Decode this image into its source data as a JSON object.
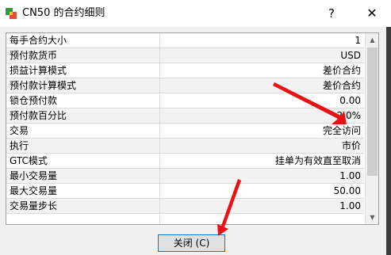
{
  "window": {
    "title": "CN50 的合约细则",
    "help_glyph": "?",
    "close_glyph": "✕"
  },
  "properties": [
    {
      "label": "每手合约大小",
      "value": "1"
    },
    {
      "label": "预付款货币",
      "value": "USD"
    },
    {
      "label": "损益计算模式",
      "value": "差价合约"
    },
    {
      "label": "预付款计算模式",
      "value": "差价合约"
    },
    {
      "label": "锁仓预付款",
      "value": "0.00"
    },
    {
      "label": "预付款百分比",
      "value": "2.0%"
    },
    {
      "label": "交易",
      "value": "完全访问"
    },
    {
      "label": "执行",
      "value": "市价"
    },
    {
      "label": "GTC模式",
      "value": "挂单为有效直至取消"
    },
    {
      "label": "最小交易量",
      "value": "1.00"
    },
    {
      "label": "最大交易量",
      "value": "50.00"
    },
    {
      "label": "交易量步长",
      "value": "1.00"
    },
    {
      "label": "",
      "value": ""
    }
  ],
  "buttons": {
    "close_label": "关闭 (C)"
  },
  "colors": {
    "accent": "#0078d7",
    "annotation_arrow": "#e81212"
  },
  "icons": {
    "app": "app-window-icon",
    "scroll_up": "scroll-up-arrow-icon",
    "scroll_down": "scroll-down-arrow-icon"
  }
}
